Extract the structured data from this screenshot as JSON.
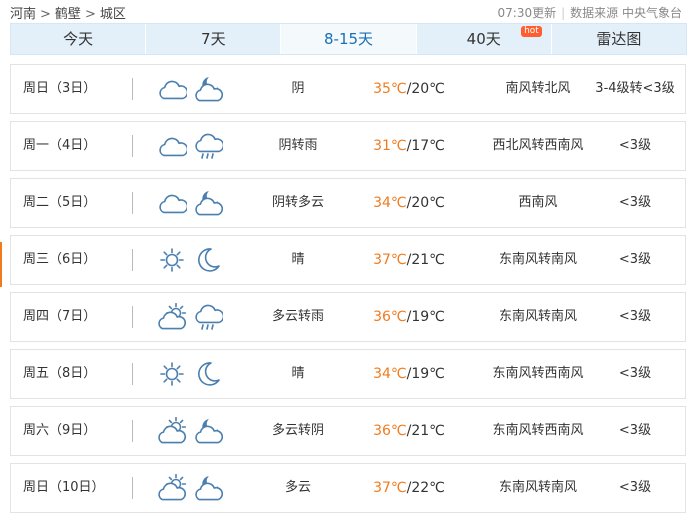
{
  "breadcrumb": [
    "河南",
    "鹤壁",
    "城区"
  ],
  "breadcrumb_sep": ">",
  "update_time": "07:30更新",
  "source_label": "数据来源 中央气象台",
  "tabs": [
    {
      "label": "今天"
    },
    {
      "label": "7天"
    },
    {
      "label": "8-15天",
      "active": true
    },
    {
      "label": "40天",
      "badge": "hot"
    },
    {
      "label": "雷达图"
    }
  ],
  "forecast": [
    {
      "day": "周日（3日）",
      "icon_day": "cloudy-icon",
      "icon_night": "cloudy-moon-icon",
      "weather": "阴",
      "high": "35℃",
      "low": "20℃",
      "wind_dir": "南风转北风",
      "wind_level": "3-4级转<3级"
    },
    {
      "day": "周一（4日）",
      "icon_day": "cloudy-icon",
      "icon_night": "rain-icon",
      "weather": "阴转雨",
      "high": "31℃",
      "low": "17℃",
      "wind_dir": "西北风转西南风",
      "wind_level": "<3级"
    },
    {
      "day": "周二（5日）",
      "icon_day": "cloudy-icon",
      "icon_night": "cloudy-moon-icon",
      "weather": "阴转多云",
      "high": "34℃",
      "low": "20℃",
      "wind_dir": "西南风",
      "wind_level": "<3级"
    },
    {
      "day": "周三（6日）",
      "icon_day": "sunny-icon",
      "icon_night": "moon-icon",
      "weather": "晴",
      "high": "37℃",
      "low": "21℃",
      "wind_dir": "东南风转南风",
      "wind_level": "<3级"
    },
    {
      "day": "周四（7日）",
      "icon_day": "partly-cloudy-icon",
      "icon_night": "rain-icon",
      "weather": "多云转雨",
      "high": "36℃",
      "low": "19℃",
      "wind_dir": "东南风转南风",
      "wind_level": "<3级"
    },
    {
      "day": "周五（8日）",
      "icon_day": "sunny-icon",
      "icon_night": "moon-icon",
      "weather": "晴",
      "high": "34℃",
      "low": "19℃",
      "wind_dir": "东南风转西南风",
      "wind_level": "<3级"
    },
    {
      "day": "周六（9日）",
      "icon_day": "partly-cloudy-icon",
      "icon_night": "cloudy-moon-icon",
      "weather": "多云转阴",
      "high": "36℃",
      "low": "21℃",
      "wind_dir": "东南风转西南风",
      "wind_level": "<3级"
    },
    {
      "day": "周日（10日）",
      "icon_day": "partly-cloudy-icon",
      "icon_night": "cloudy-moon-icon",
      "weather": "多云",
      "high": "37℃",
      "low": "22℃",
      "wind_dir": "东南风转南风",
      "wind_level": "<3级"
    }
  ],
  "colors": {
    "high_temp": "#f07b1e",
    "icon": "#4a7fb0",
    "tab_bg": "#e4f0f9",
    "tab_active_text": "#1a6fb5"
  }
}
